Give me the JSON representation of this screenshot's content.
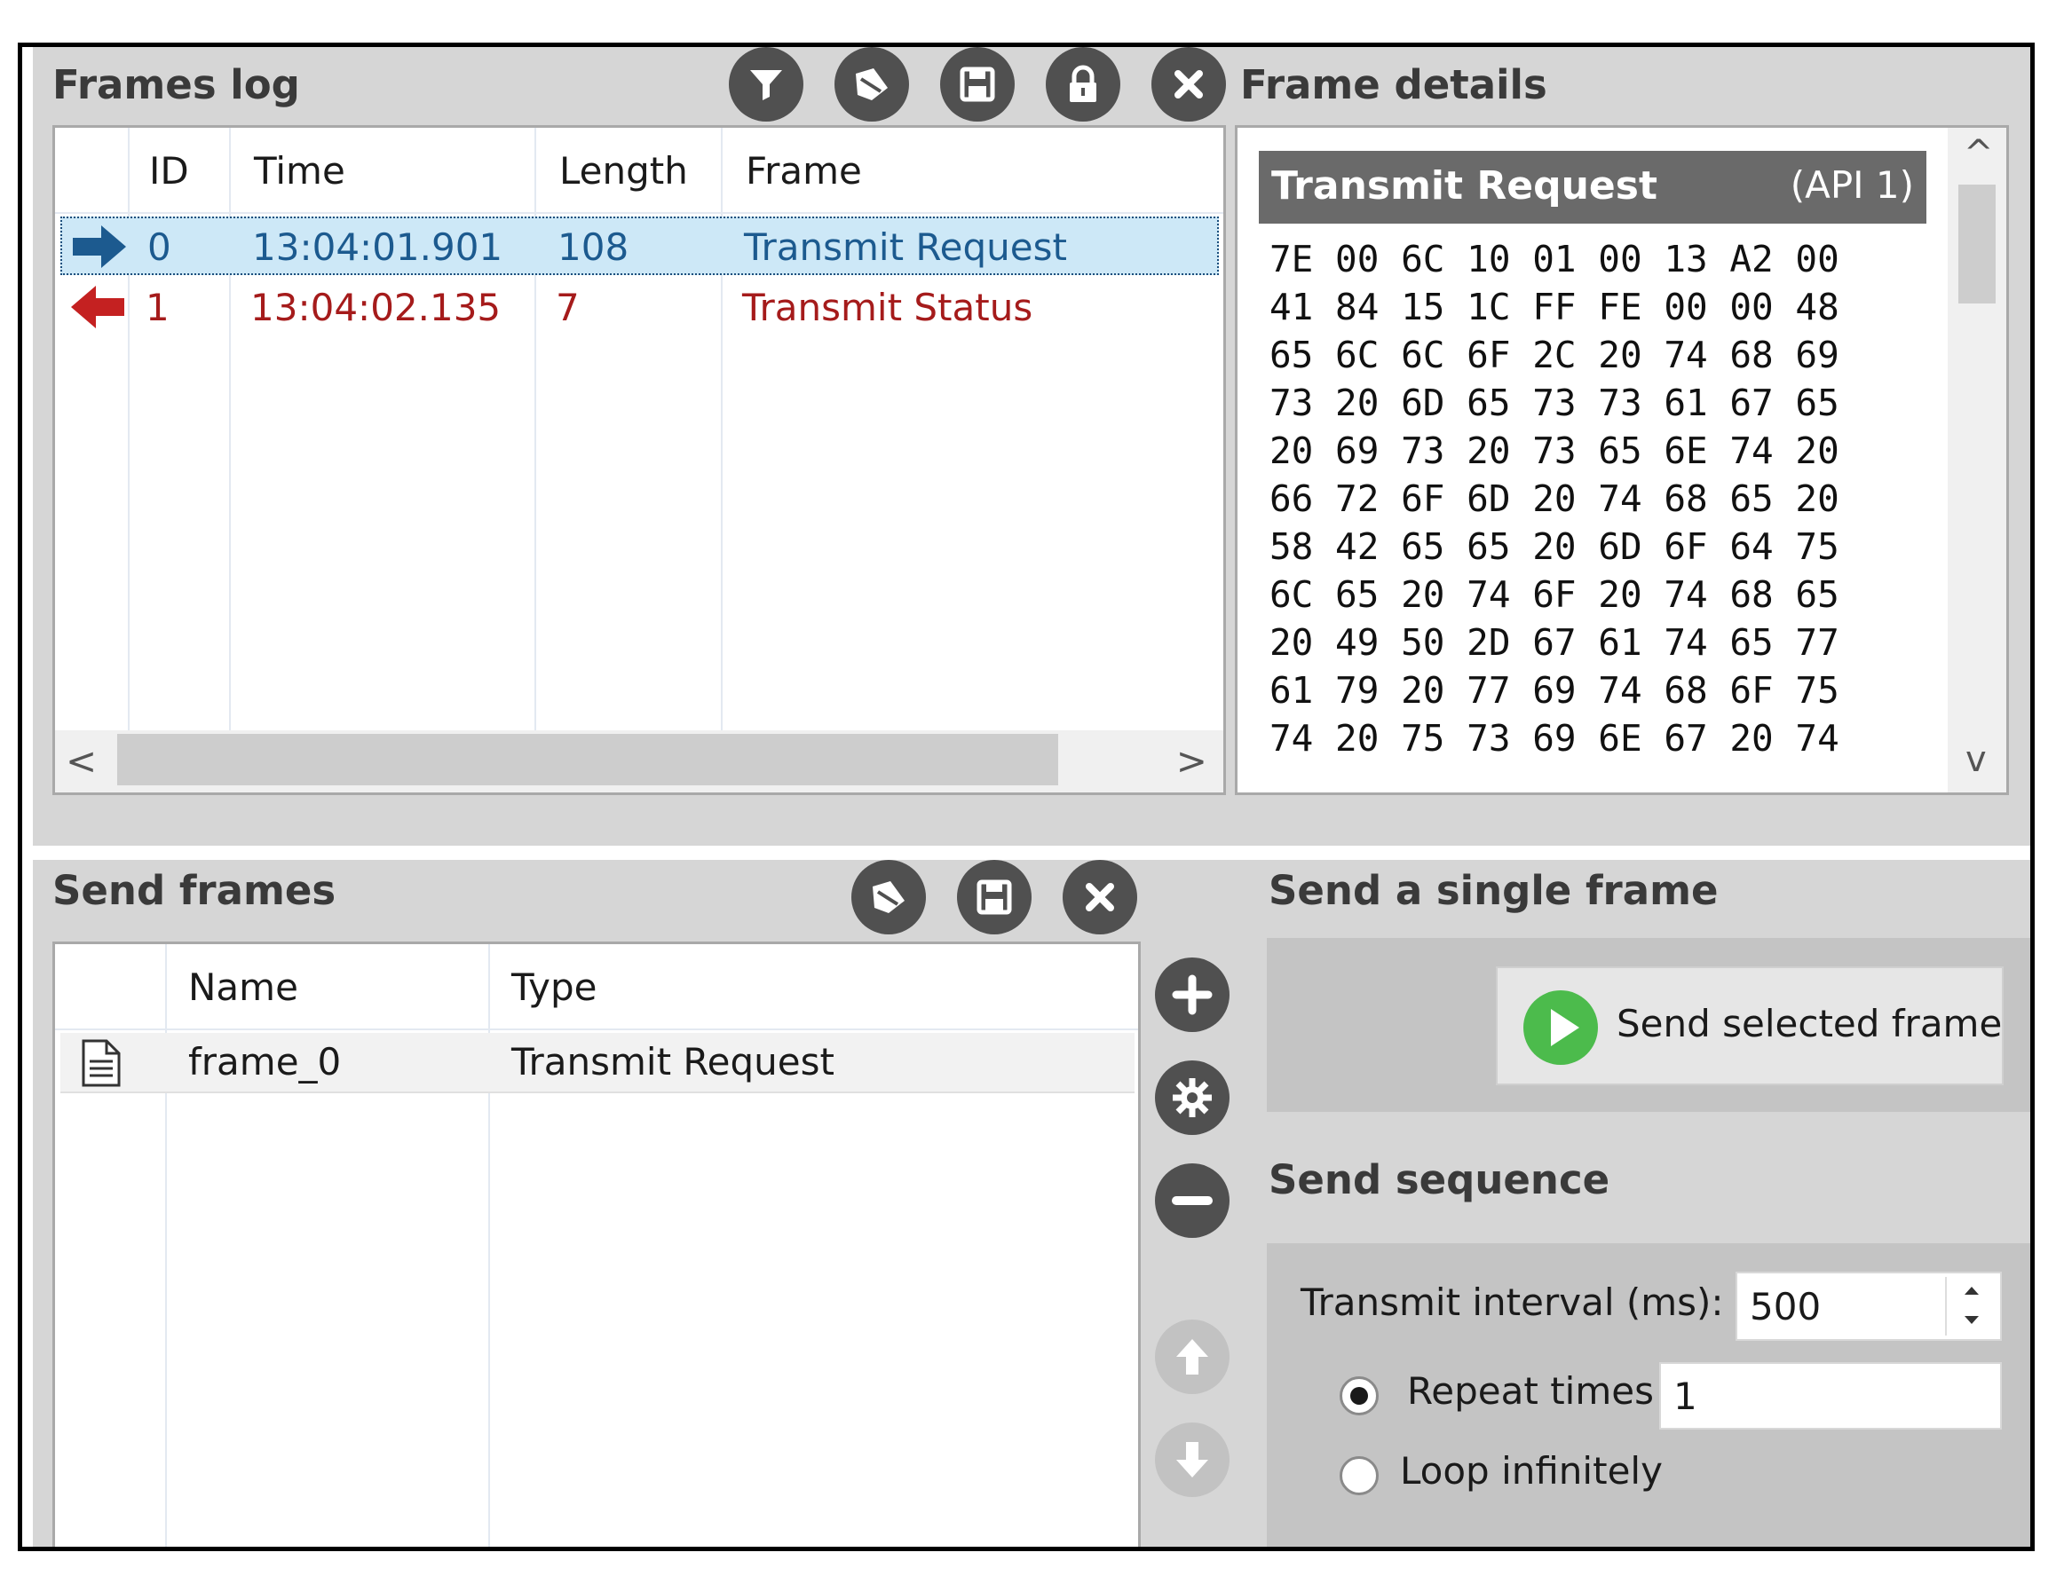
{
  "frames_log": {
    "title": "Frames log",
    "toolbar": [
      {
        "name": "filter-icon"
      },
      {
        "name": "clear-folder-icon"
      },
      {
        "name": "save-icon"
      },
      {
        "name": "lock-icon"
      },
      {
        "name": "close-icon"
      }
    ],
    "columns": [
      "ID",
      "Time",
      "Length",
      "Frame"
    ],
    "rows": [
      {
        "direction": "outgoing",
        "id": "0",
        "time": "13:04:01.901",
        "length": "108",
        "frame": "Transmit Request",
        "color": "#1c5a8f",
        "selected": true
      },
      {
        "direction": "incoming",
        "id": "1",
        "time": "13:04:02.135",
        "length": "7",
        "frame": "Transmit Status",
        "color": "#a51b1b",
        "selected": false
      }
    ],
    "scroll_left": "<",
    "scroll_right": ">"
  },
  "frame_details": {
    "title": "Frame details",
    "header_name": "Transmit Request",
    "header_api": "(API 1)",
    "hex_lines": [
      "7E 00 6C 10 01 00 13 A2 00",
      "41 84 15 1C FF FE 00 00 48",
      "65 6C 6C 6F 2C 20 74 68 69",
      "73 20 6D 65 73 73 61 67 65",
      "20 69 73 20 73 65 6E 74 20",
      "66 72 6F 6D 20 74 68 65 20",
      "58 42 65 65 20 6D 6F 64 75",
      "6C 65 20 74 6F 20 74 68 65",
      "20 49 50 2D 67 61 74 65 77",
      "61 79 20 77 69 74 68 6F 75",
      "74 20 75 73 69 6E 67 20 74"
    ],
    "scroll_up": "^",
    "scroll_down": "v"
  },
  "send_frames": {
    "title": "Send frames",
    "toolbar": [
      {
        "name": "clear-folder-icon"
      },
      {
        "name": "save-icon"
      },
      {
        "name": "close-icon"
      }
    ],
    "columns": [
      "Name",
      "Type"
    ],
    "rows": [
      {
        "name": "frame_0",
        "type": "Transmit Request"
      }
    ],
    "side_buttons": [
      {
        "name": "add-icon",
        "enabled": true
      },
      {
        "name": "settings-icon",
        "enabled": true
      },
      {
        "name": "remove-icon",
        "enabled": true
      },
      {
        "name": "move-up-icon",
        "enabled": false
      },
      {
        "name": "move-down-icon",
        "enabled": false
      }
    ]
  },
  "send_single": {
    "title": "Send a single frame",
    "button_label": "Send selected frame"
  },
  "send_sequence": {
    "title": "Send sequence",
    "interval_label": "Transmit interval (ms):",
    "interval_value": "500",
    "repeat_label": "Repeat times",
    "repeat_value": "1",
    "loop_label": "Loop infinitely",
    "selected_mode": "repeat"
  },
  "colors": {
    "panel_bg": "#d6d6d6",
    "icon_dark": "#505050",
    "selection": "#cde8f7",
    "outgoing": "#1c5a8f",
    "incoming": "#a51b1b",
    "play_green": "#4cbb4c"
  }
}
